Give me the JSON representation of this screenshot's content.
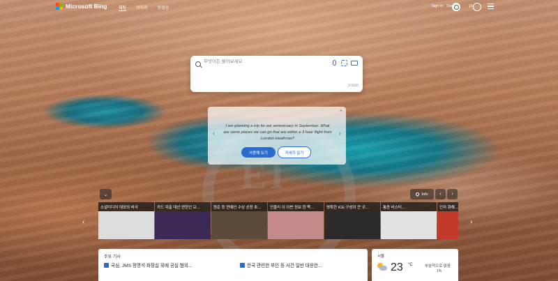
{
  "header": {
    "brand": "Microsoft Bing",
    "nav": [
      "채팅",
      "이미지",
      "동영상"
    ],
    "signin": "Sign in",
    "username": "Daniel",
    "points": "16"
  },
  "search": {
    "placeholder": "무엇이든 물어보세요",
    "counter": "0/1000"
  },
  "suggestion": {
    "close": "×",
    "prompt": "I am planning a trip for our anniversary in September. What are some places we can go that are within a 3 hour flight from London Heathrow?",
    "try_label": "사용해 보기",
    "more_label": "자세히 알기",
    "prev": "‹",
    "next": "›"
  },
  "image_controls": {
    "collapse": "⌄",
    "info": "Info",
    "prev": "‹",
    "next": "›"
  },
  "news_strip": [
    {
      "title": "소셜미디어 대모의 비극",
      "color": "#dcdcdc"
    },
    {
      "title": "카드 대출 대산 연한인 오…",
      "color": "#3a2a55"
    },
    {
      "title": "원준 등 연예인 수상 선정 호…",
      "color": "#5c4a3a"
    },
    {
      "title": "인블리 이 이번 정보 한 쪽…",
      "color": "#c48a8a"
    },
    {
      "title": "명확한 ICE 구성이 큰 규…",
      "color": "#2b2b2b"
    },
    {
      "title": "통증 비스터…",
      "color": "#e2e2e2"
    },
    {
      "title": "인자 화해…",
      "color": "#c23a2a"
    }
  ],
  "news_panel": {
    "heading": "주요 기사",
    "items": [
      "국심, JMS 정명석 화장실 위에 공실 혐의...",
      "한국 관련한 부인 등 사건 일반 대응한..."
    ]
  },
  "weather": {
    "location": "서울",
    "temp": "23",
    "unit": "°C",
    "desc": "부분적으로 맑음",
    "rain": "1%"
  }
}
